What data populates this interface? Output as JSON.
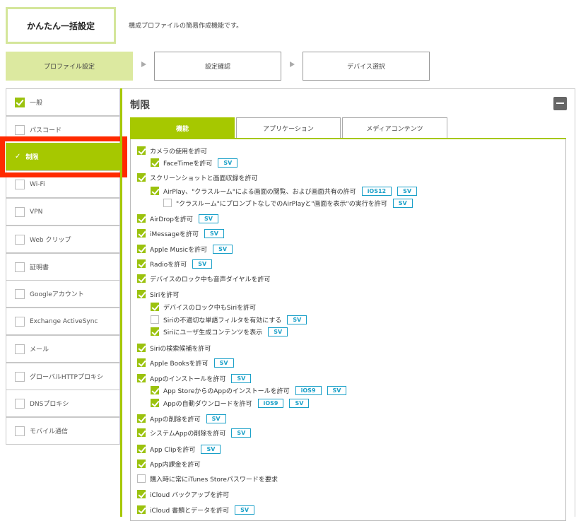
{
  "header": {
    "title": "かんたん一括設定",
    "description": "構成プロファイルの簡易作成機能です。"
  },
  "steps": [
    {
      "label": "プロファイル設定",
      "active": true
    },
    {
      "label": "設定確認",
      "active": false
    },
    {
      "label": "デバイス選択",
      "active": false
    }
  ],
  "sidebar": {
    "items": [
      {
        "label": "一般",
        "checked": true,
        "selected": false
      },
      {
        "label": "パスコード",
        "checked": false,
        "selected": false
      },
      {
        "label": "制限",
        "checked": true,
        "selected": true
      },
      {
        "label": "Wi-Fi",
        "checked": false,
        "selected": false
      },
      {
        "label": "VPN",
        "checked": false,
        "selected": false
      },
      {
        "label": "Web クリップ",
        "checked": false,
        "selected": false
      },
      {
        "label": "証明書",
        "checked": false,
        "selected": false
      },
      {
        "label": "Googleアカウント",
        "checked": false,
        "selected": false
      },
      {
        "label": "Exchange ActiveSync",
        "checked": false,
        "selected": false
      },
      {
        "label": "メール",
        "checked": false,
        "selected": false
      },
      {
        "label": "グローバルHTTPプロキシ",
        "checked": false,
        "selected": false
      },
      {
        "label": "DNSプロキシ",
        "checked": false,
        "selected": false
      },
      {
        "label": "モバイル通信",
        "checked": false,
        "selected": false
      }
    ]
  },
  "main": {
    "section_title": "制限",
    "tabs": [
      {
        "label": "機能",
        "active": true
      },
      {
        "label": "アプリケーション",
        "active": false
      },
      {
        "label": "メディアコンテンツ",
        "active": false
      }
    ],
    "options": [
      {
        "label": "カメラの使用を許可",
        "checked": true,
        "level": 0,
        "badges": []
      },
      {
        "label": "FaceTimeを許可",
        "checked": true,
        "level": 1,
        "badges": [
          "SV"
        ]
      },
      {
        "label": "スクリーンショットと画面収録を許可",
        "checked": true,
        "level": 0,
        "badges": []
      },
      {
        "label": "AirPlay、\"クラスルーム\"による画面の閲覧、および画面共有の許可",
        "checked": true,
        "level": 1,
        "badges": [
          "iOS12",
          "SV"
        ]
      },
      {
        "label": "\"クラスルーム\"にプロンプトなしでのAirPlayと\"画面を表示\"の実行を許可",
        "checked": false,
        "level": 2,
        "badges": [
          "SV"
        ]
      },
      {
        "label": "AirDropを許可",
        "checked": true,
        "level": 0,
        "badges": [
          "SV"
        ]
      },
      {
        "label": "iMessageを許可",
        "checked": true,
        "level": 0,
        "badges": [
          "SV"
        ]
      },
      {
        "label": "Apple Musicを許可",
        "checked": true,
        "level": 0,
        "badges": [
          "SV"
        ]
      },
      {
        "label": "Radioを許可",
        "checked": true,
        "level": 0,
        "badges": [
          "SV"
        ]
      },
      {
        "label": "デバイスのロック中も音声ダイヤルを許可",
        "checked": true,
        "level": 0,
        "badges": []
      },
      {
        "label": "Siriを許可",
        "checked": true,
        "level": 0,
        "badges": []
      },
      {
        "label": "デバイスのロック中もSiriを許可",
        "checked": true,
        "level": 1,
        "badges": []
      },
      {
        "label": "Siriの不適切な単語フィルタを有効にする",
        "checked": false,
        "level": 1,
        "badges": [
          "SV"
        ]
      },
      {
        "label": "Siriにユーザ生成コンテンツを表示",
        "checked": true,
        "level": 1,
        "badges": [
          "SV"
        ]
      },
      {
        "label": "Siriの検索候補を許可",
        "checked": true,
        "level": 0,
        "badges": []
      },
      {
        "label": "Apple Booksを許可",
        "checked": true,
        "level": 0,
        "badges": [
          "SV"
        ]
      },
      {
        "label": "Appのインストールを許可",
        "checked": true,
        "level": 0,
        "badges": [
          "SV"
        ]
      },
      {
        "label": "App StoreからのAppのインストールを許可",
        "checked": true,
        "level": 1,
        "badges": [
          "iOS9",
          "SV"
        ]
      },
      {
        "label": "Appの自動ダウンロードを許可",
        "checked": true,
        "level": 1,
        "badges": [
          "iOS9",
          "SV"
        ]
      },
      {
        "label": "Appの削除を許可",
        "checked": true,
        "level": 0,
        "badges": [
          "SV"
        ]
      },
      {
        "label": "システムAppの削除を許可",
        "checked": true,
        "level": 0,
        "badges": [
          "SV"
        ]
      },
      {
        "label": "App Clipを許可",
        "checked": true,
        "level": 0,
        "badges": [
          "SV"
        ]
      },
      {
        "label": "App内課金を許可",
        "checked": true,
        "level": 0,
        "badges": []
      },
      {
        "label": "購入時に常にiTunes Storeパスワードを要求",
        "checked": false,
        "level": 0,
        "badges": []
      },
      {
        "label": "iCloud バックアップを許可",
        "checked": true,
        "level": 0,
        "badges": []
      },
      {
        "label": "iCloud 書類とデータを許可",
        "checked": true,
        "level": 0,
        "badges": [
          "SV"
        ]
      }
    ]
  },
  "colors": {
    "accent": "#a6c800",
    "highlight": "#ff2a00",
    "badge": "#1aa0c8"
  }
}
